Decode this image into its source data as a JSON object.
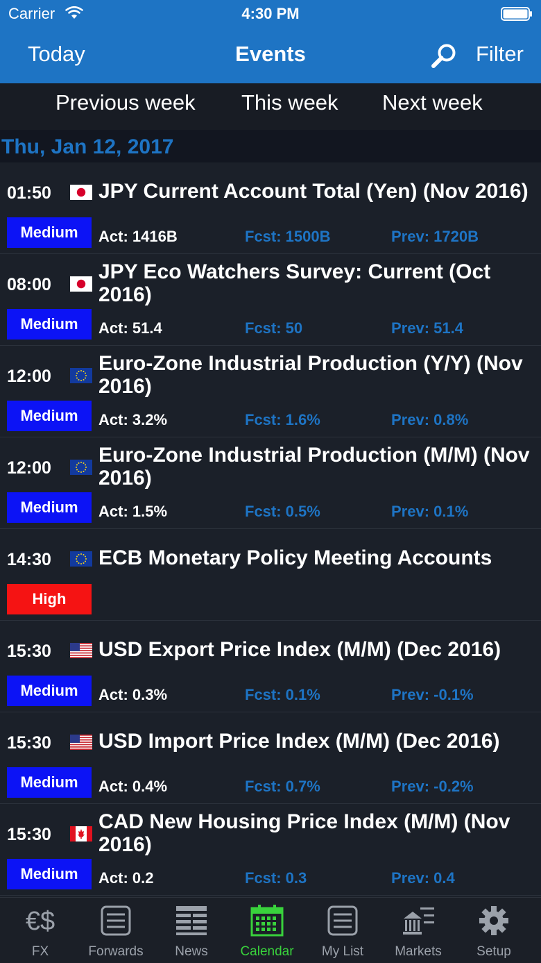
{
  "status_bar": {
    "carrier": "Carrier",
    "time": "4:30 PM"
  },
  "nav": {
    "left": "Today",
    "title": "Events",
    "right": "Filter"
  },
  "week_tabs": [
    "Previous week",
    "This week",
    "Next week"
  ],
  "date_header": "Thu, Jan 12, 2017",
  "events": [
    {
      "time": "01:50",
      "flag": "jp-flag-icon",
      "title": "JPY Current Account Total (Yen) (Nov 2016)",
      "importance": "Medium",
      "actual": "Act: 1416B",
      "forecast": "Fcst: 1500B",
      "previous": "Prev: 1720B"
    },
    {
      "time": "08:00",
      "flag": "jp-flag-icon",
      "title": "JPY Eco Watchers Survey: Current (Oct 2016)",
      "importance": "Medium",
      "actual": "Act: 51.4",
      "forecast": "Fcst: 50",
      "previous": "Prev: 51.4"
    },
    {
      "time": "12:00",
      "flag": "eu-flag-icon",
      "title": "Euro-Zone Industrial Production (Y/Y) (Nov 2016)",
      "importance": "Medium",
      "actual": "Act: 3.2%",
      "forecast": "Fcst: 1.6%",
      "previous": "Prev: 0.8%"
    },
    {
      "time": "12:00",
      "flag": "eu-flag-icon",
      "title": "Euro-Zone Industrial Production (M/M) (Nov 2016)",
      "importance": "Medium",
      "actual": "Act: 1.5%",
      "forecast": "Fcst: 0.5%",
      "previous": "Prev: 0.1%"
    },
    {
      "time": "14:30",
      "flag": "eu-flag-icon",
      "title": "ECB Monetary Policy Meeting Accounts",
      "importance": "High",
      "actual": "",
      "forecast": "",
      "previous": ""
    },
    {
      "time": "15:30",
      "flag": "us-flag-icon",
      "title": "USD Export Price Index (M/M) (Dec 2016)",
      "importance": "Medium",
      "actual": "Act: 0.3%",
      "forecast": "Fcst: 0.1%",
      "previous": "Prev: -0.1%"
    },
    {
      "time": "15:30",
      "flag": "us-flag-icon",
      "title": "USD Import Price Index (M/M) (Dec 2016)",
      "importance": "Medium",
      "actual": "Act: 0.4%",
      "forecast": "Fcst: 0.7%",
      "previous": "Prev: -0.2%"
    },
    {
      "time": "15:30",
      "flag": "ca-flag-icon",
      "title": "CAD New Housing Price Index (M/M) (Nov 2016)",
      "importance": "Medium",
      "actual": "Act: 0.2",
      "forecast": "Fcst: 0.3",
      "previous": "Prev: 0.4"
    }
  ],
  "tabs": [
    {
      "label": "FX",
      "icon": "currency-icon"
    },
    {
      "label": "Forwards",
      "icon": "forwards-icon"
    },
    {
      "label": "News",
      "icon": "news-icon"
    },
    {
      "label": "Calendar",
      "icon": "calendar-icon",
      "active": true
    },
    {
      "label": "My List",
      "icon": "list-icon"
    },
    {
      "label": "Markets",
      "icon": "markets-icon"
    },
    {
      "label": "Setup",
      "icon": "gear-icon"
    }
  ],
  "colors": {
    "accent": "#1e74c4",
    "medium": "#0c13f5",
    "high": "#f51313",
    "active_tab": "#39d23c"
  }
}
